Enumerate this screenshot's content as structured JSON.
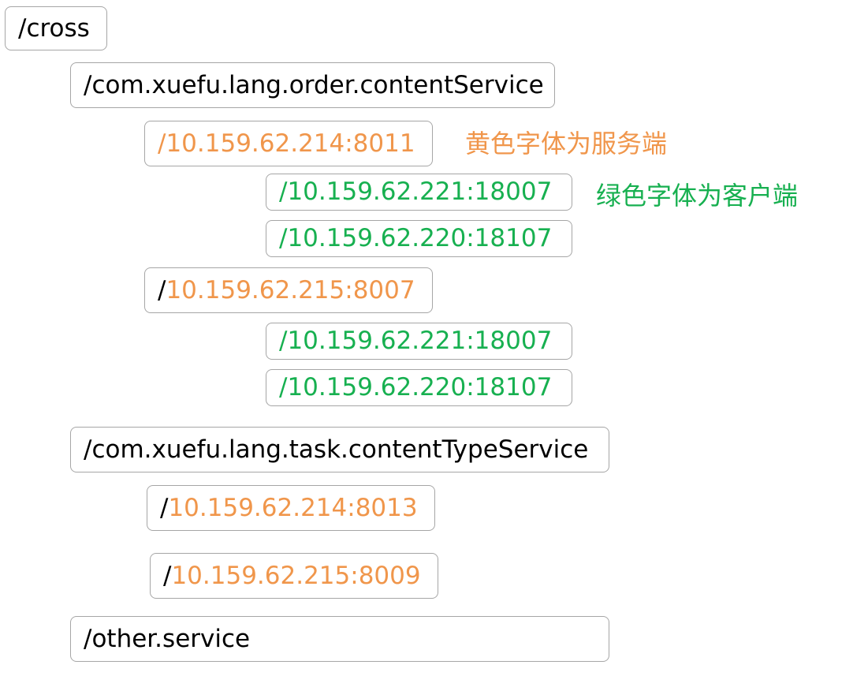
{
  "colors": {
    "server": "#f0964b",
    "client": "#17b050",
    "text": "#000000",
    "border": "#a6a6a6"
  },
  "root": {
    "label": "/cross"
  },
  "services": [
    {
      "label": "/com.xuefu.lang.order.contentService",
      "servers": [
        {
          "prefix": "",
          "address": "/10.159.62.214:8011",
          "clients": [
            "/10.159.62.221:18007",
            "/10.159.62.220:18107"
          ]
        },
        {
          "prefix": "/",
          "address": "10.159.62.215:8007",
          "clients": [
            "/10.159.62.221:18007",
            "/10.159.62.220:18107"
          ]
        }
      ]
    },
    {
      "label": "/com.xuefu.lang.task.contentTypeService",
      "servers": [
        {
          "prefix": "/",
          "address": "10.159.62.214:8013",
          "clients": []
        },
        {
          "prefix": "/",
          "address": "10.159.62.215:8009",
          "clients": []
        }
      ]
    },
    {
      "label": "/other.service",
      "servers": []
    }
  ],
  "legend": {
    "server_note": "黄色字体为服务端",
    "client_note": "绿色字体为客户端"
  }
}
